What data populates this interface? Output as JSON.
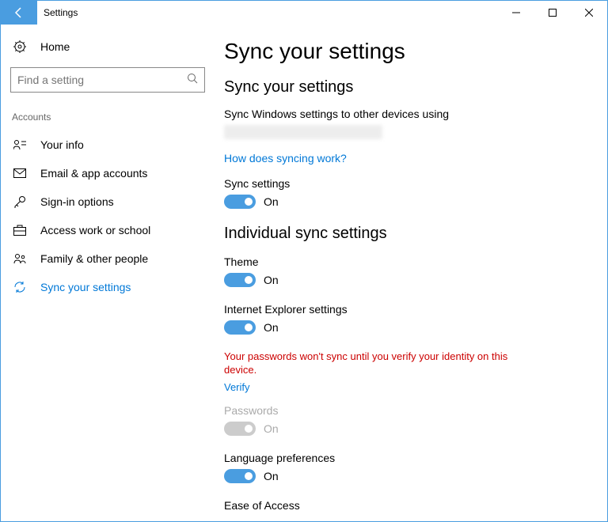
{
  "titlebar": {
    "title": "Settings"
  },
  "sidebar": {
    "home": "Home",
    "search_placeholder": "Find a setting",
    "section": "Accounts",
    "items": [
      {
        "label": "Your info"
      },
      {
        "label": "Email & app accounts"
      },
      {
        "label": "Sign-in options"
      },
      {
        "label": "Access work or school"
      },
      {
        "label": "Family & other people"
      },
      {
        "label": "Sync your settings"
      }
    ]
  },
  "main": {
    "title": "Sync your settings",
    "subtitle": "Sync your settings",
    "description": "Sync Windows settings to other devices using",
    "help_link": "How does syncing work?",
    "sync_settings_label": "Sync settings",
    "on_text": "On",
    "individual_title": "Individual sync settings",
    "theme_label": "Theme",
    "ie_label": "Internet Explorer settings",
    "warning": "Your passwords won't sync until you verify your identity on this device.",
    "verify": "Verify",
    "passwords_label": "Passwords",
    "lang_label": "Language preferences",
    "ease_label": "Ease of Access"
  }
}
